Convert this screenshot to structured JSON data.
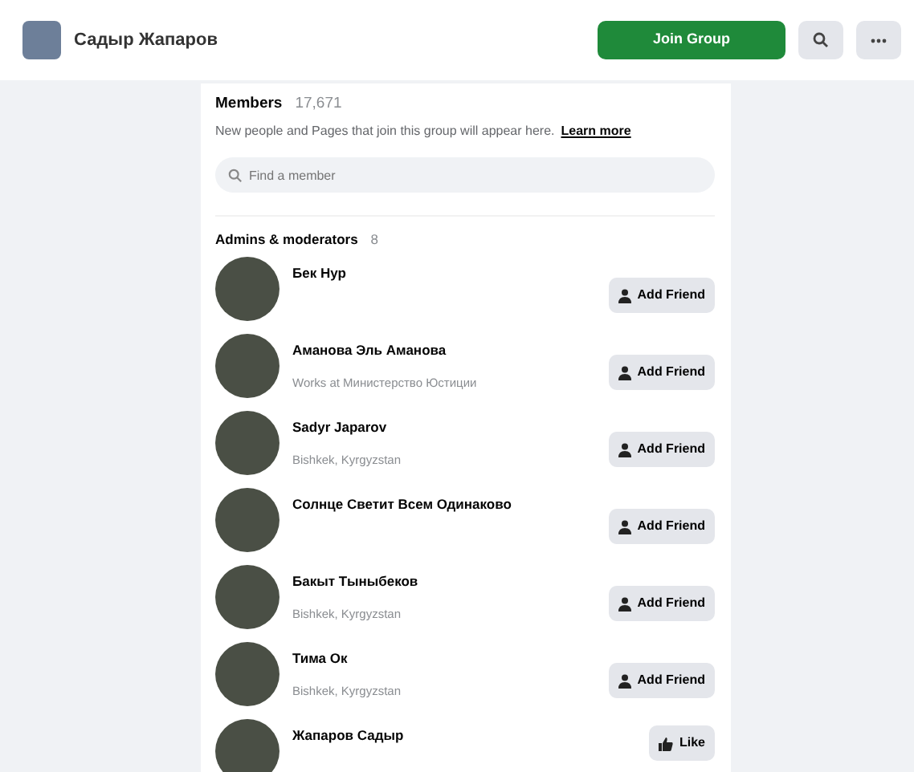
{
  "header": {
    "title": "Садыр Жапаров",
    "join_button": "Join Group"
  },
  "members": {
    "title": "Members",
    "count": "17,671",
    "note": "New people and Pages that join this group will appear here.",
    "learn_more": "Learn more",
    "search": {
      "placeholder": "Find a member"
    }
  },
  "admins": {
    "title": "Admins & moderators",
    "count": "8",
    "people": [
      {
        "name": "Бек Нур",
        "action": "Add Friend",
        "kind": "friend"
      },
      {
        "name": "Аманова Эль Аманова",
        "subtitle": "Works at Министерство Юстиции",
        "action": "Add Friend",
        "kind": "friend"
      },
      {
        "name": "Sadyr Japarov",
        "subtitle": "Bishkek, Kyrgyzstan",
        "action": "Add Friend",
        "kind": "friend"
      },
      {
        "name": "Солнце Светит Всем Одинаково",
        "action": "Add Friend",
        "kind": "friend"
      },
      {
        "name": "Бакыт Тыныбеков",
        "subtitle": "Bishkek, Kyrgyzstan",
        "action": "Add Friend",
        "kind": "friend"
      },
      {
        "name": "Тима Ок",
        "subtitle": "Bishkek, Kyrgyzstan",
        "action": "Add Friend",
        "kind": "friend"
      },
      {
        "name": "Жапаров Садыр",
        "action": "Like",
        "kind": "page"
      }
    ]
  }
}
